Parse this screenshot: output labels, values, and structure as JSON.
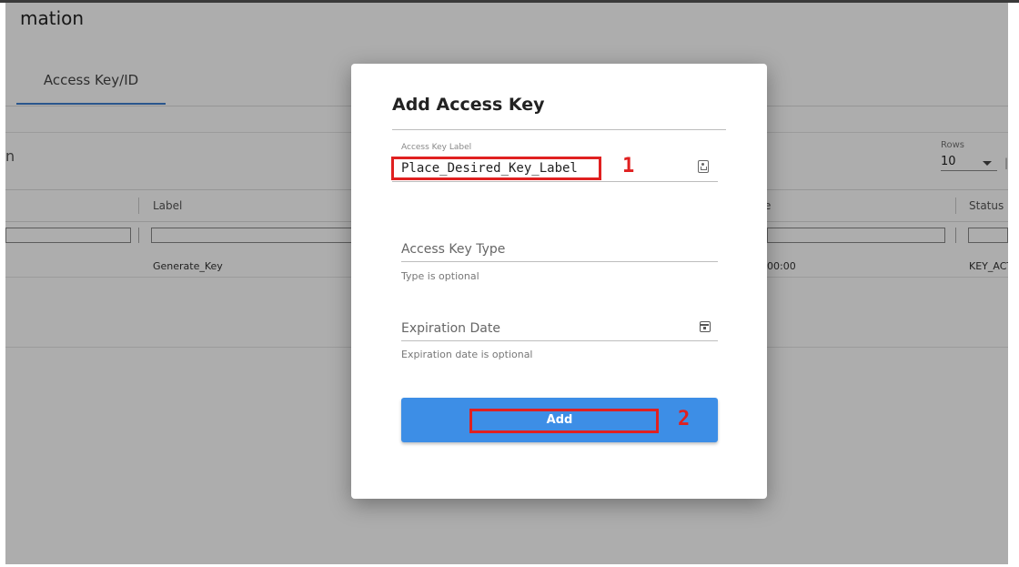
{
  "background": {
    "page_title": "mation",
    "tab_label": "Access Key/ID",
    "search_fragment": "n",
    "rows_label": "Rows",
    "rows_value": "10",
    "pager_first": "|<",
    "columns": [
      "Label",
      "e",
      "Status"
    ],
    "rows": [
      {
        "label": "Generate_Key",
        "date_fragment": "00:00",
        "status": "KEY_ACTIV"
      }
    ]
  },
  "dialog": {
    "title": "Add Access Key",
    "access_key_label": {
      "label": "Access Key Label",
      "value": "Place_Desired_Key_Label"
    },
    "access_key_type": {
      "placeholder": "Access Key Type",
      "hint": "Type is optional"
    },
    "expiration_date": {
      "placeholder": "Expiration Date",
      "hint": "Expiration date is optional"
    },
    "add_button_label": "Add"
  },
  "annotations": {
    "marker_1": "1",
    "marker_2": "2",
    "color": "#e02020"
  },
  "colors": {
    "accent": "#3d8ee6",
    "tab_underline": "#3f7fd0",
    "overlay": "rgba(0,0,0,0.32)"
  },
  "icons": {
    "label_field_icon": "contact-card-icon",
    "date_field_icon": "calendar-icon",
    "rows_dropdown_icon": "caret-down-icon"
  }
}
